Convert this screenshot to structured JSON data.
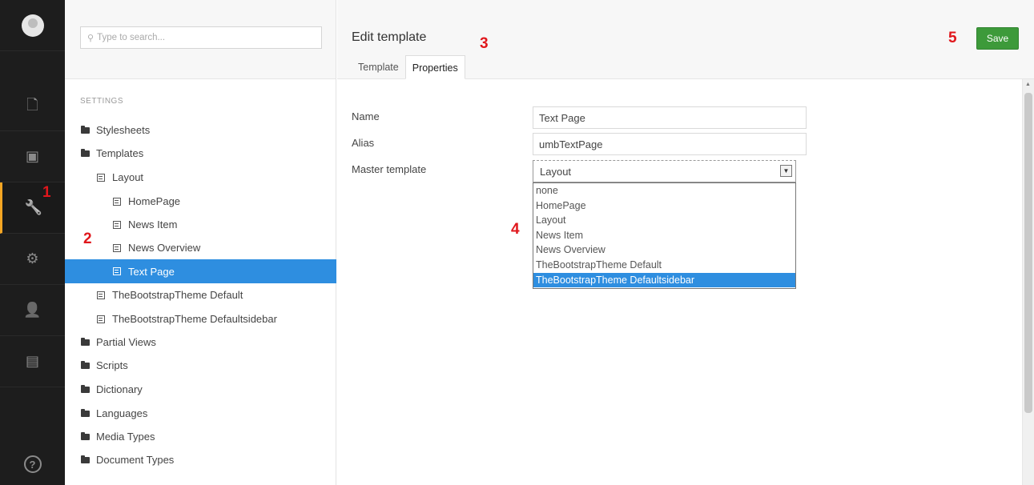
{
  "sidebar_icons": [
    {
      "name": "user-avatar",
      "glyph": ""
    },
    {
      "name": "content-icon",
      "glyph": "🗋"
    },
    {
      "name": "media-icon",
      "glyph": "▣"
    },
    {
      "name": "settings-wrench-icon",
      "glyph": "🔧"
    },
    {
      "name": "developer-gear-icon",
      "glyph": "⚙"
    },
    {
      "name": "users-icon",
      "glyph": "👤"
    },
    {
      "name": "members-card-icon",
      "glyph": "▤"
    },
    {
      "name": "help-icon",
      "glyph": "?"
    }
  ],
  "search": {
    "placeholder": "Type to search..."
  },
  "tree": {
    "section_label": "SETTINGS",
    "items": [
      {
        "label": "Stylesheets",
        "icon": "folder-icon"
      },
      {
        "label": "Templates",
        "icon": "folder-icon"
      },
      {
        "label": "Layout",
        "icon": "template-icon"
      },
      {
        "label": "HomePage",
        "icon": "template-icon"
      },
      {
        "label": "News Item",
        "icon": "template-icon"
      },
      {
        "label": "News Overview",
        "icon": "template-icon"
      },
      {
        "label": "Text Page",
        "icon": "template-icon",
        "selected": true
      },
      {
        "label": "TheBootstrapTheme Default",
        "icon": "template-icon"
      },
      {
        "label": "TheBootstrapTheme Defaultsidebar",
        "icon": "template-icon"
      },
      {
        "label": "Partial Views",
        "icon": "folder-icon"
      },
      {
        "label": "Scripts",
        "icon": "folder-icon"
      },
      {
        "label": "Dictionary",
        "icon": "folder-icon"
      },
      {
        "label": "Languages",
        "icon": "folder-icon"
      },
      {
        "label": "Media Types",
        "icon": "folder-icon"
      },
      {
        "label": "Document Types",
        "icon": "folder-icon"
      }
    ]
  },
  "editor": {
    "title": "Edit template",
    "tabs": [
      {
        "label": "Template",
        "active": false
      },
      {
        "label": "Properties",
        "active": true
      }
    ],
    "save_label": "Save",
    "fields": {
      "name_label": "Name",
      "name_value": "Text Page",
      "alias_label": "Alias",
      "alias_value": "umbTextPage",
      "master_label": "Master template",
      "master_value": "Layout"
    },
    "master_options": [
      "none",
      "HomePage",
      "Layout",
      "News Item",
      "News Overview",
      "TheBootstrapTheme Default",
      "TheBootstrapTheme Defaultsidebar"
    ],
    "highlighted_option": "TheBootstrapTheme Defaultsidebar"
  },
  "markers": [
    "1",
    "2",
    "3",
    "4",
    "5"
  ],
  "colors": {
    "accent_selected": "#2e8ee0",
    "save_green": "#3d9a3a",
    "sidebar_bg": "#1d1d1d",
    "active_indicator": "#f5a623",
    "marker_red": "#e0171c"
  }
}
